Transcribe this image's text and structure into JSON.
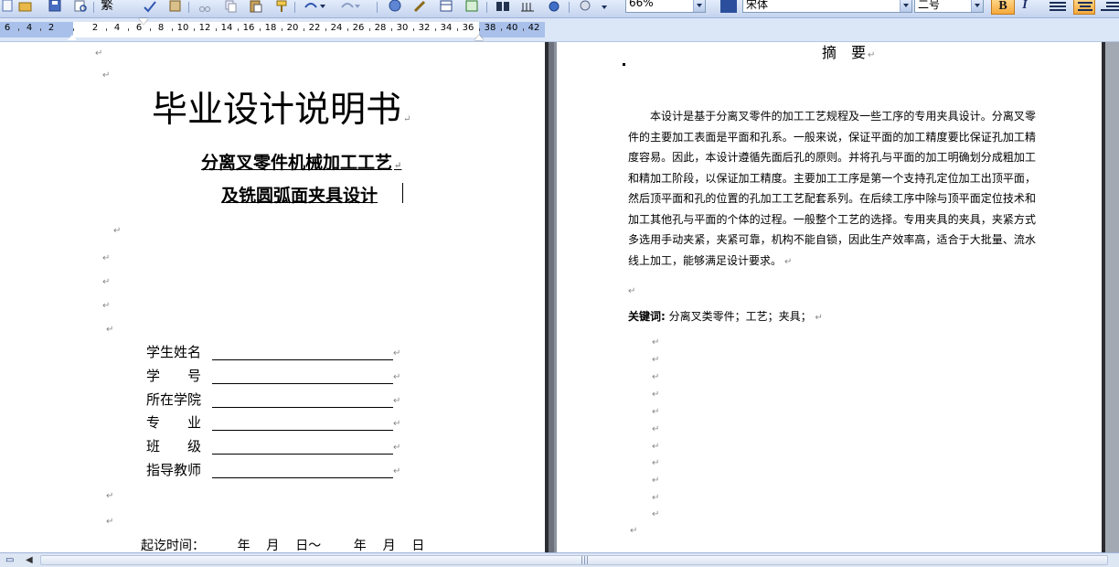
{
  "toolbar": {
    "zoom_value": "66%",
    "style_value": "",
    "font_value": "宋体",
    "size_value": "二号",
    "font_partial_label": "繁",
    "bold_label": "B",
    "italic_label": "I"
  },
  "ruler": {
    "numbers": [
      "6",
      "4",
      "2",
      "2",
      "4",
      "6",
      "8",
      "10",
      "12",
      "14",
      "16",
      "18",
      "20",
      "22",
      "24",
      "26",
      "28",
      "30",
      "32",
      "34",
      "36",
      "38",
      "40",
      "42"
    ]
  },
  "left_page": {
    "title": "毕业设计说明书",
    "subtitle_line1": "分离叉零件机械加工工艺",
    "subtitle_line2": "及铣圆弧面夹具设计",
    "form": [
      {
        "label": "学生姓名"
      },
      {
        "label": "学　　号"
      },
      {
        "label": "所在学院"
      },
      {
        "label": "专　　业"
      },
      {
        "label": "班　　级"
      },
      {
        "label": "指导教师"
      }
    ],
    "time_row": "起讫时间：        年    月    日～        年    月    日"
  },
  "right_page": {
    "abstract_title": "摘　要",
    "abstract_body": "本设计是基于分离叉零件的加工工艺规程及一些工序的专用夹具设计。分离叉零件的主要加工表面是平面和孔系。一般来说，保证平面的加工精度要比保证孔加工精度容易。因此，本设计遵循先面后孔的原则。并将孔与平面的加工明确划分成粗加工和精加工阶段，以保证加工精度。主要加工工序是第一个支持孔定位加工出顶平面，然后顶平面和孔的位置的孔加工工艺配套系列。在后续工序中除与顶平面定位技术和加工其他孔与平面的个体的过程。一般整个工艺的选择。专用夹具的夹具，夹紧方式多选用手动夹紧，夹紧可靠，机构不能自锁，因此生产效率高，适合于大批量、流水线上加工，能够满足设计要求。",
    "keywords_label": "关键词:",
    "keywords_value": "分离叉类零件；工艺；夹具；"
  },
  "marks": {
    "paragraph": "↵"
  },
  "colors": {
    "toolbar_bg": "#c4d3ee",
    "ruler_margin": "#a9c1ea",
    "workspace": "#abb0b8",
    "highlight": "#f5a83c"
  }
}
